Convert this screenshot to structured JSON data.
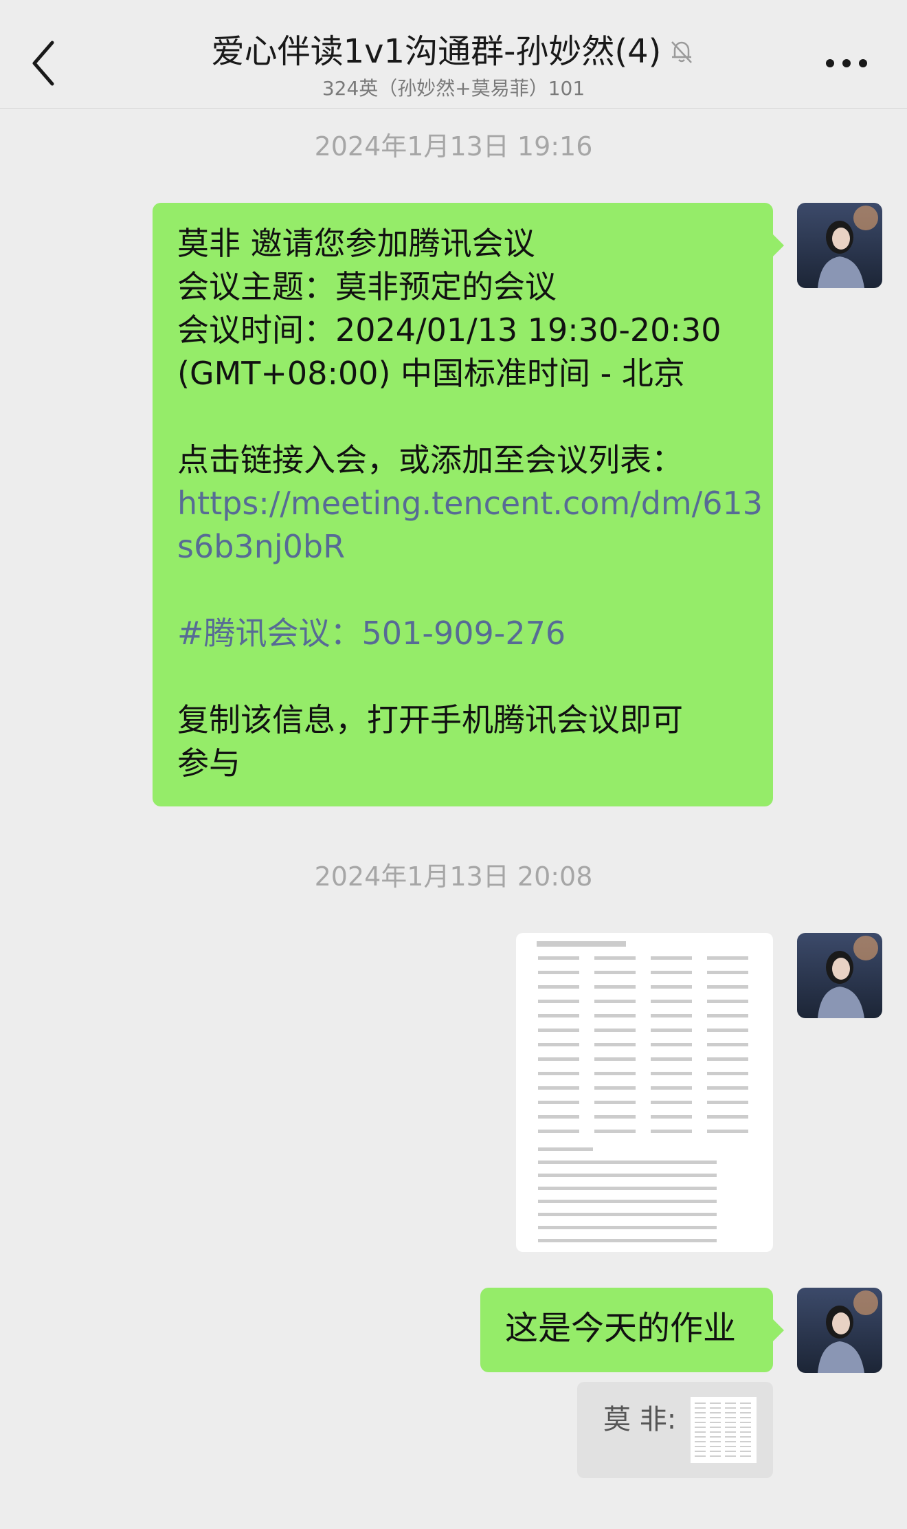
{
  "header": {
    "back_icon": "chevron-left-icon",
    "title": "爱心伴读1v1沟通群-孙妙然(4)",
    "mute_icon": "bell-slash-icon",
    "subtitle": "324英（孙妙然+莫易菲）101",
    "more_icon": "more-dots-icon"
  },
  "messages": {
    "timestamp_1": "2024年1月13日 19:16",
    "invite": {
      "line1": "莫非 邀请您参加腾讯会议",
      "line2": "会议主题：莫非预定的会议",
      "line3": "会议时间：2024/01/13 19:30-20:30",
      "line4": "(GMT+08:00) 中国标准时间 - 北京",
      "line5": "点击链接入会，或添加至会议列表：",
      "link_line1": "https://meeting.tencent.com/dm/613",
      "link_line2": "s6b3nj0bR",
      "meeting_id": "#腾讯会议：501-909-276",
      "line6": "复制该信息，打开手机腾讯会议即可",
      "line7": "参与"
    },
    "timestamp_2": "2024年1月13日 20:08",
    "homework_image": "homework-worksheet-image",
    "homework_text": "这是今天的作业",
    "quote": {
      "sender": "莫 非:",
      "thumb": "worksheet-thumbnail-image"
    }
  },
  "colors": {
    "background": "#ededed",
    "bubble_green": "#95ec69",
    "link_blue": "#576b95",
    "timestamp_gray": "#a6a6a6"
  }
}
